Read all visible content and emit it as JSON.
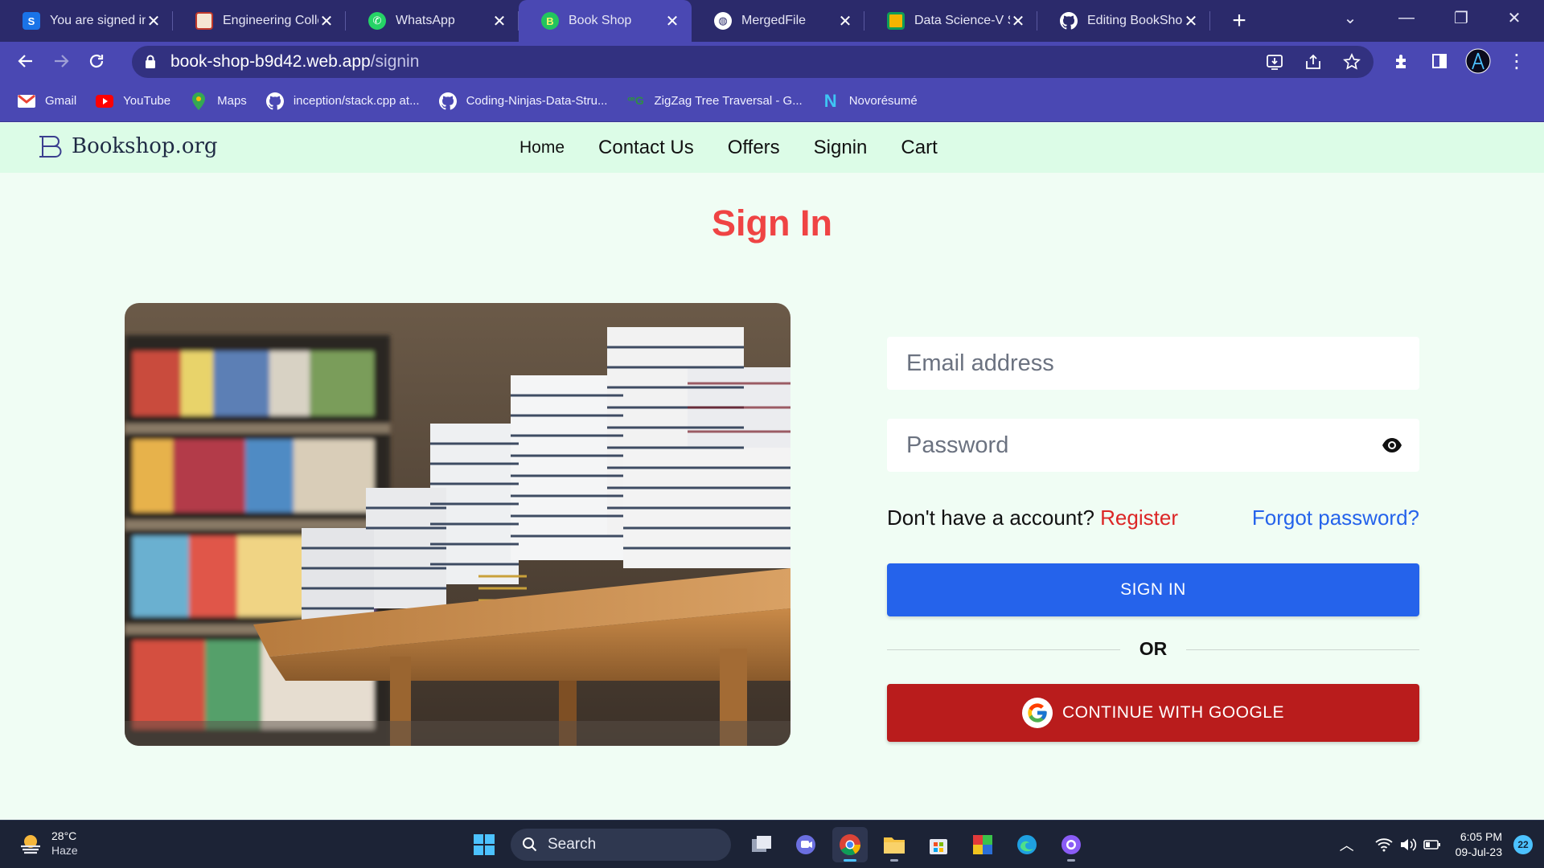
{
  "browser": {
    "tabs": [
      {
        "title": "You are signed in",
        "icon": "s-app-icon",
        "color": "#1a73e8"
      },
      {
        "title": "Engineering Colle",
        "icon": "college-crest-icon",
        "color": "#d9534f"
      },
      {
        "title": "WhatsApp",
        "icon": "whatsapp-icon",
        "color": "#25d366"
      },
      {
        "title": "Book Shop",
        "icon": "bookshop-b-icon",
        "color": "#22c55e",
        "active": true
      },
      {
        "title": "MergedFile",
        "icon": "globe-icon",
        "color": "#ffffff"
      },
      {
        "title": "Data Science-V Se",
        "icon": "classroom-icon",
        "color": "#f4b400"
      },
      {
        "title": "Editing BookShop",
        "icon": "github-icon",
        "color": "#ffffff"
      }
    ],
    "address": {
      "host": "book-shop-b9d42.web.app",
      "path": "/signin"
    },
    "bookmarks": [
      {
        "label": "Gmail",
        "icon": "gmail-icon"
      },
      {
        "label": "YouTube",
        "icon": "youtube-icon"
      },
      {
        "label": "Maps",
        "icon": "maps-pin-icon"
      },
      {
        "label": "inception/stack.cpp at...",
        "icon": "github-icon"
      },
      {
        "label": "Coding-Ninjas-Data-Stru...",
        "icon": "github-icon"
      },
      {
        "label": "ZigZag Tree Traversal - G...",
        "icon": "gfg-icon"
      },
      {
        "label": "Novorésumé",
        "icon": "novoresume-icon"
      }
    ]
  },
  "site": {
    "brand": "Bookshop.org",
    "nav": [
      "Home",
      "Contact Us",
      "Offers",
      "Signin",
      "Cart"
    ]
  },
  "signin": {
    "title": "Sign In",
    "email_placeholder": "Email address",
    "password_placeholder": "Password",
    "no_account": "Don't have a account?",
    "register": "Register",
    "forgot": "Forgot password?",
    "signin_button": "SIGN IN",
    "or": "OR",
    "google_button": "CONTINUE WITH GOOGLE"
  },
  "taskbar": {
    "temperature": "28°C",
    "condition": "Haze",
    "search": "Search",
    "time": "6:05 PM",
    "date": "09-Jul-23",
    "notifications": "22"
  },
  "colors": {
    "accent_red": "#ef4444",
    "primary_blue": "#2563eb",
    "google_red": "#b91c1c",
    "page_bg": "#f0fdf4",
    "nav_bg": "#dcfce7"
  }
}
